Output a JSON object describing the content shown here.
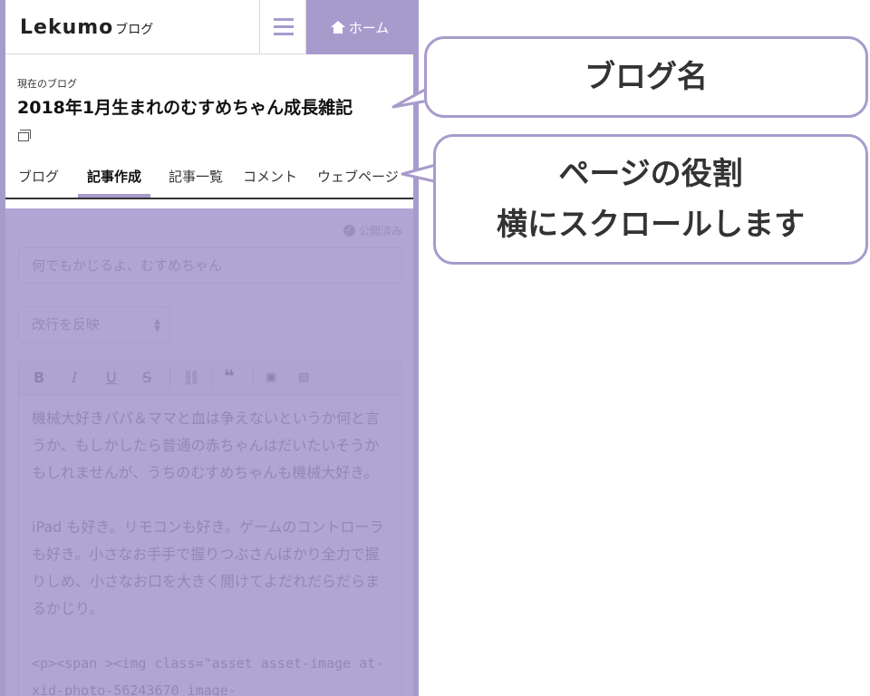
{
  "app": {
    "logo_main": "Lekumo",
    "logo_sub": "ブログ",
    "home_label": "ホーム"
  },
  "blog": {
    "current_label": "現在のブログ",
    "name": "2018年1月生まれのむすめちゃん成長雑記"
  },
  "tabs": [
    {
      "label": "ブログ"
    },
    {
      "label": "記事作成",
      "active": true
    },
    {
      "label": "記事一覧"
    },
    {
      "label": "コメント"
    },
    {
      "label": "ウェブページ"
    }
  ],
  "editor": {
    "status": "公開済み",
    "title_value": "何でもかじるよ、むすめちゃん",
    "format_value": "改行を反映",
    "toolbar": [
      "B",
      "I",
      "U",
      "S",
      "link",
      "quote",
      "image",
      "file"
    ],
    "body": [
      "機械大好きパパ＆ママと血は争えないというか何と言うか、もしかしたら普通の赤ちゃんはだいたいそうかもしれませんが、うちのむすめちゃんも機械大好き。",
      "iPad も好き。リモコンも好き。ゲームのコントローラも好き。小さなお手手で握りつぶさんばかり全力で握りしめ、小さなお口を大きく開けてよだれだらだらまるかじり。",
      "<p><span ><img class=\"asset  asset-image at-xid-photo-56243670 image-"
    ]
  },
  "callouts": {
    "blog_name": "ブログ名",
    "page_role_line1": "ページの役割",
    "page_role_line2": "横にスクロールします"
  },
  "colors": {
    "accent": "#a79bcc",
    "overlay": "#9b8cc8"
  }
}
